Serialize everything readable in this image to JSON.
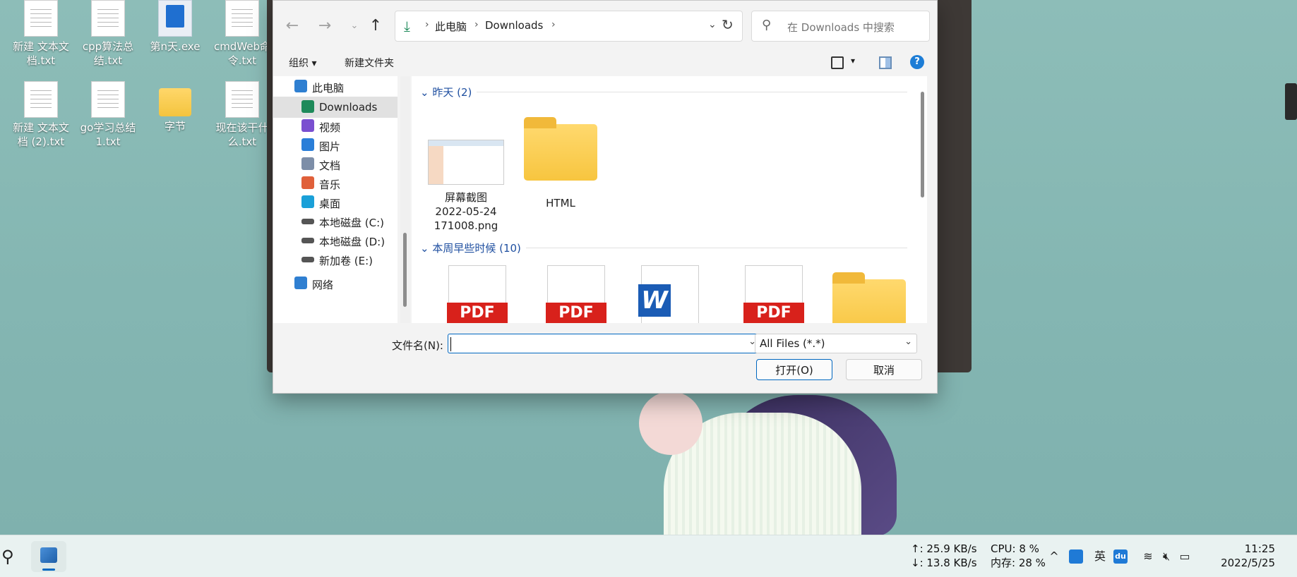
{
  "desktop": {
    "icons": [
      {
        "label": "新建 文本文档.txt"
      },
      {
        "label": "cpp算法总结.txt"
      },
      {
        "label": "第n天.exe"
      },
      {
        "label": "cmdWeb命令.txt"
      },
      {
        "label": "新建 文本文档 (2).txt"
      },
      {
        "label": "go学习总结1.txt"
      },
      {
        "label": "字节"
      },
      {
        "label": "现在该干什么.txt"
      }
    ]
  },
  "dialog": {
    "address": {
      "crumbs": [
        "此电脑",
        "Downloads"
      ],
      "separator": "›"
    },
    "search_placeholder": "在 Downloads 中搜索",
    "toolbar": {
      "organize": "组织 ▾",
      "new_folder": "新建文件夹",
      "help": "?"
    },
    "nav": {
      "items": [
        {
          "label": "此电脑",
          "icon": "computer-icon"
        },
        {
          "label": "Downloads",
          "icon": "download-icon",
          "selected": true
        },
        {
          "label": "视频",
          "icon": "video-icon"
        },
        {
          "label": "图片",
          "icon": "picture-icon"
        },
        {
          "label": "文档",
          "icon": "document-icon"
        },
        {
          "label": "音乐",
          "icon": "music-icon"
        },
        {
          "label": "桌面",
          "icon": "desktop-icon"
        },
        {
          "label": "本地磁盘 (C:)",
          "icon": "drive-icon"
        },
        {
          "label": "本地磁盘 (D:)",
          "icon": "drive-icon"
        },
        {
          "label": "新加卷 (E:)",
          "icon": "drive-icon"
        },
        {
          "label": "网络",
          "icon": "network-icon"
        }
      ]
    },
    "groups": [
      {
        "header": "昨天 (2)"
      },
      {
        "header": "本周早些时候 (10)"
      }
    ],
    "files_yesterday": [
      {
        "name": "屏幕截图 2022-05-24 171008.png",
        "line1": "屏幕截图",
        "line2": "2022-05-24",
        "line3": "171008.png",
        "type": "image"
      },
      {
        "name": "HTML",
        "type": "folder"
      }
    ],
    "files_earlier": [
      {
        "type": "pdf",
        "badge": "PDF"
      },
      {
        "type": "pdf",
        "badge": "PDF"
      },
      {
        "type": "word",
        "badge": "W"
      },
      {
        "type": "pdf",
        "badge": "PDF"
      },
      {
        "type": "folder"
      }
    ],
    "filename_label": "文件名(N):",
    "filename_value": "",
    "filetype_value": "All Files (*.*)",
    "open_button": "打开(O)",
    "cancel_button": "取消"
  },
  "taskbar": {
    "net_up": "↑: 25.9 KB/s",
    "net_down": "↓: 13.8 KB/s",
    "cpu": "CPU: 8 %",
    "mem": "内存: 28 %",
    "ime": "英",
    "baidu": "du",
    "time": "11:25",
    "date": "2022/5/25"
  }
}
